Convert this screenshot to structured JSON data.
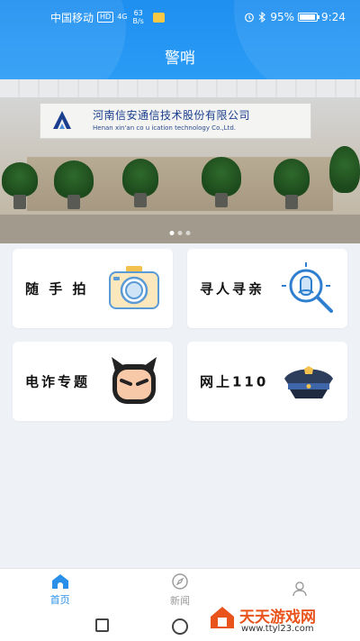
{
  "status_bar": {
    "carrier": "中国移动",
    "hd_badge": "HD",
    "network": "4G",
    "speed_value": "63",
    "speed_unit": "B/s",
    "battery_percent": "95%",
    "battery_level": 0.95,
    "time": "9:24",
    "icons": [
      "alarm-icon",
      "bluetooth-icon",
      "battery-icon",
      "notification-icon"
    ]
  },
  "header": {
    "title": "警哨"
  },
  "banner": {
    "sign_text": "河南信安通信技术股份有限公司",
    "sign_subtext": "Henan xin'an co    u ication technology Co.,Ltd.",
    "slide_count": 3,
    "active_slide": 1
  },
  "cards": [
    {
      "label": "随 手 拍",
      "icon": "camera-icon"
    },
    {
      "label": "寻人寻亲",
      "icon": "person-search-icon"
    },
    {
      "label": "电诈专题",
      "icon": "devil-face-icon"
    },
    {
      "label": "网上110",
      "icon": "police-cap-icon"
    }
  ],
  "tabbar": {
    "tabs": [
      {
        "label": "首页",
        "icon": "home-icon",
        "active": true
      },
      {
        "label": "新闻",
        "icon": "compass-icon",
        "active": false
      },
      {
        "label": "",
        "icon": "user-icon",
        "active": false
      }
    ]
  },
  "watermark": {
    "title": "天天游戏网",
    "url": "www.ttyl23.com"
  },
  "colors": {
    "primary": "#2a8fe8",
    "header_bg": "#1f8ff0",
    "page_bg": "#eef2f7"
  }
}
